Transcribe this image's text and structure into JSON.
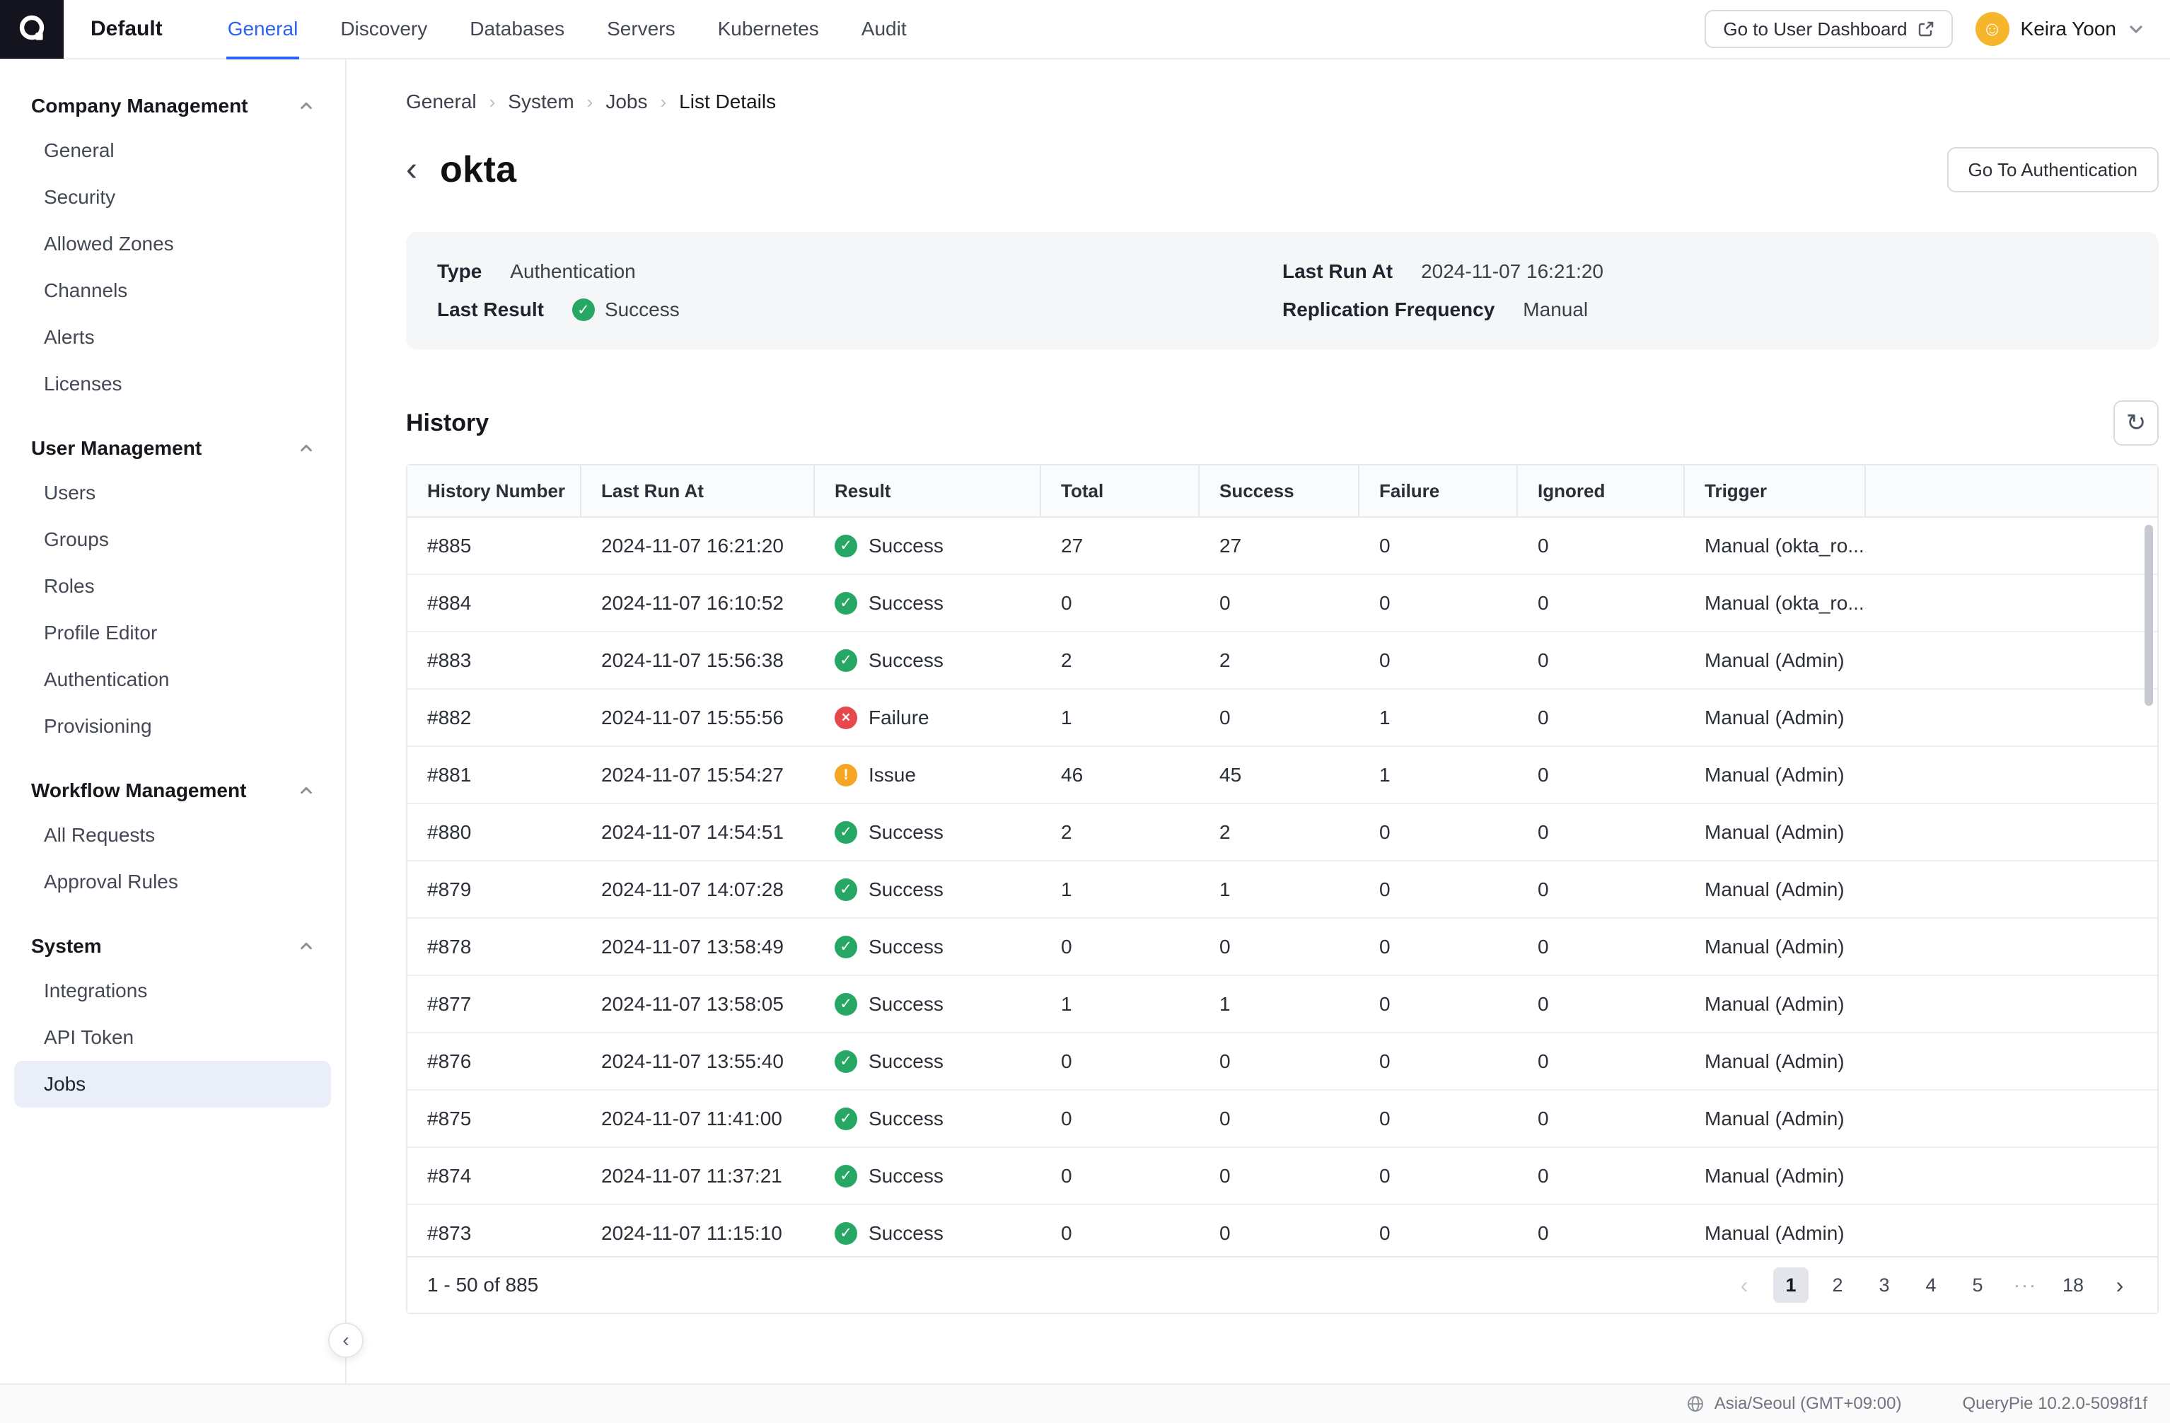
{
  "colors": {
    "accent": "#2c62f6",
    "success": "#27a764",
    "failure": "#e5484d",
    "issue": "#f5a623"
  },
  "nav": {
    "workspace": "Default",
    "tabs": [
      {
        "label": "General",
        "active": true
      },
      {
        "label": "Discovery"
      },
      {
        "label": "Databases"
      },
      {
        "label": "Servers"
      },
      {
        "label": "Kubernetes"
      },
      {
        "label": "Audit"
      }
    ],
    "dashboard_button": "Go to User Dashboard",
    "user_name": "Keira Yoon"
  },
  "sidebar": {
    "sections": [
      {
        "title": "Company Management",
        "items": [
          "General",
          "Security",
          "Allowed Zones",
          "Channels",
          "Alerts",
          "Licenses"
        ]
      },
      {
        "title": "User Management",
        "items": [
          "Users",
          "Groups",
          "Roles",
          "Profile Editor",
          "Authentication",
          "Provisioning"
        ]
      },
      {
        "title": "Workflow Management",
        "items": [
          "All Requests",
          "Approval Rules"
        ]
      },
      {
        "title": "System",
        "items": [
          "Integrations",
          "API Token",
          "Jobs"
        ],
        "selected": "Jobs"
      }
    ]
  },
  "breadcrumb": [
    "General",
    "System",
    "Jobs",
    "List Details"
  ],
  "page": {
    "title": "okta",
    "action_button": "Go To Authentication",
    "info": {
      "type_label": "Type",
      "type_value": "Authentication",
      "last_result_label": "Last Result",
      "last_result_value": "Success",
      "last_run_label": "Last Run At",
      "last_run_value": "2024-11-07 16:21:20",
      "replication_label": "Replication Frequency",
      "replication_value": "Manual"
    }
  },
  "history": {
    "title": "History",
    "columns": [
      "History Number",
      "Last Run At",
      "Result",
      "Total",
      "Success",
      "Failure",
      "Ignored",
      "Trigger"
    ],
    "rows": [
      {
        "number": "#885",
        "last_run_at": "2024-11-07 16:21:20",
        "result": "Success",
        "total": "27",
        "success": "27",
        "failure": "0",
        "ignored": "0",
        "trigger": "Manual (okta_ro..."
      },
      {
        "number": "#884",
        "last_run_at": "2024-11-07 16:10:52",
        "result": "Success",
        "total": "0",
        "success": "0",
        "failure": "0",
        "ignored": "0",
        "trigger": "Manual (okta_ro..."
      },
      {
        "number": "#883",
        "last_run_at": "2024-11-07 15:56:38",
        "result": "Success",
        "total": "2",
        "success": "2",
        "failure": "0",
        "ignored": "0",
        "trigger": "Manual (Admin)"
      },
      {
        "number": "#882",
        "last_run_at": "2024-11-07 15:55:56",
        "result": "Failure",
        "total": "1",
        "success": "0",
        "failure": "1",
        "ignored": "0",
        "trigger": "Manual (Admin)"
      },
      {
        "number": "#881",
        "last_run_at": "2024-11-07 15:54:27",
        "result": "Issue",
        "total": "46",
        "success": "45",
        "failure": "1",
        "ignored": "0",
        "trigger": "Manual (Admin)"
      },
      {
        "number": "#880",
        "last_run_at": "2024-11-07 14:54:51",
        "result": "Success",
        "total": "2",
        "success": "2",
        "failure": "0",
        "ignored": "0",
        "trigger": "Manual (Admin)"
      },
      {
        "number": "#879",
        "last_run_at": "2024-11-07 14:07:28",
        "result": "Success",
        "total": "1",
        "success": "1",
        "failure": "0",
        "ignored": "0",
        "trigger": "Manual (Admin)"
      },
      {
        "number": "#878",
        "last_run_at": "2024-11-07 13:58:49",
        "result": "Success",
        "total": "0",
        "success": "0",
        "failure": "0",
        "ignored": "0",
        "trigger": "Manual (Admin)"
      },
      {
        "number": "#877",
        "last_run_at": "2024-11-07 13:58:05",
        "result": "Success",
        "total": "1",
        "success": "1",
        "failure": "0",
        "ignored": "0",
        "trigger": "Manual (Admin)"
      },
      {
        "number": "#876",
        "last_run_at": "2024-11-07 13:55:40",
        "result": "Success",
        "total": "0",
        "success": "0",
        "failure": "0",
        "ignored": "0",
        "trigger": "Manual (Admin)"
      },
      {
        "number": "#875",
        "last_run_at": "2024-11-07 11:41:00",
        "result": "Success",
        "total": "0",
        "success": "0",
        "failure": "0",
        "ignored": "0",
        "trigger": "Manual (Admin)"
      },
      {
        "number": "#874",
        "last_run_at": "2024-11-07 11:37:21",
        "result": "Success",
        "total": "0",
        "success": "0",
        "failure": "0",
        "ignored": "0",
        "trigger": "Manual (Admin)"
      },
      {
        "number": "#873",
        "last_run_at": "2024-11-07 11:15:10",
        "result": "Success",
        "total": "0",
        "success": "0",
        "failure": "0",
        "ignored": "0",
        "trigger": "Manual (Admin)"
      }
    ],
    "pagination": {
      "summary": "1 - 50 of 885",
      "active": "1",
      "pages": [
        "1",
        "2",
        "3",
        "4",
        "5",
        "···",
        "18"
      ]
    }
  },
  "footer": {
    "timezone": "Asia/Seoul (GMT+09:00)",
    "version": "QueryPie 10.2.0-5098f1f"
  }
}
